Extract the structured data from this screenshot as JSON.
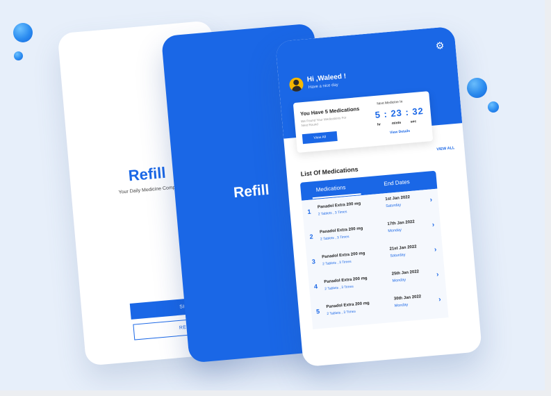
{
  "brand": {
    "name": "Refill",
    "tagline": "Your Daily Medicine Compa"
  },
  "auth": {
    "sign_in": "SIGN IN",
    "register": "REGISTER"
  },
  "home": {
    "greeting": "Hi ,Waleed !",
    "subgreeting": "Have a nice day",
    "summary": {
      "title": "You Have 5 Medications",
      "subtitle": "We Found Your Medications For Next Round",
      "view_all": "View All",
      "next_label": "Next Medicine In",
      "time": "5 : 23 : 32",
      "units": [
        "hr",
        "mints",
        "sec"
      ],
      "view_details": "View Details"
    },
    "view_all_link": "VIEW ALL",
    "list_title": "List Of Medications",
    "tabs": [
      "Medications",
      "End Dates"
    ],
    "medications": [
      {
        "num": "1",
        "name": "Panadol Extra 200 mg",
        "dose": "2 Tablets , 3 Times",
        "date": "1st Jan 2022",
        "day": "Saturday"
      },
      {
        "num": "2",
        "name": "Panadol Extra 200 mg",
        "dose": "2 Tablets , 3 Times",
        "date": "17th Jan 2022",
        "day": "Monday"
      },
      {
        "num": "3",
        "name": "Panadol Extra 200 mg",
        "dose": "2 Tablets , 3 Times",
        "date": "21st Jan 2022",
        "day": "Saturday"
      },
      {
        "num": "4",
        "name": "Panadol Extra 200 mg",
        "dose": "2 Tablets , 3 Times",
        "date": "25th Jan 2022",
        "day": "Monday"
      },
      {
        "num": "5",
        "name": "Panadol Extra 200 mg",
        "dose": "2 Tablets , 3 Times",
        "date": "30th Jan 2022",
        "day": "Monday"
      }
    ]
  },
  "icons": {
    "settings": "gear-icon",
    "chevron": "chevron-right-icon",
    "avatar": "user-avatar"
  },
  "colors": {
    "accent": "#1a67e6",
    "background": "#e7effa",
    "avatar": "#f5b800"
  }
}
